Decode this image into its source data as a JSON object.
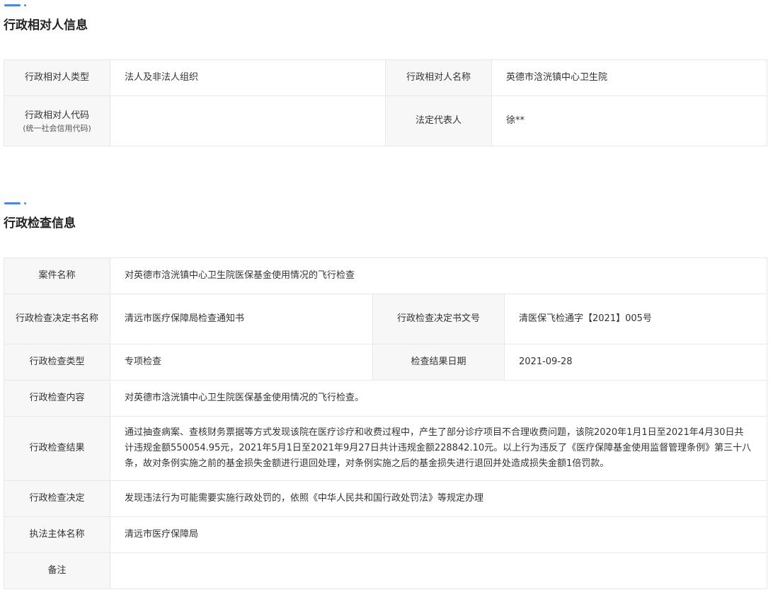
{
  "party_section": {
    "title": "行政相对人信息",
    "rows": {
      "type_label": "行政相对人类型",
      "type_value": "法人及非法人组织",
      "name_label": "行政相对人名称",
      "name_value": "英德市浛洸镇中心卫生院",
      "code_label": "行政相对人代码",
      "code_sublabel": "(统一社会信用代码)",
      "code_value": "",
      "rep_label": "法定代表人",
      "rep_value": "徐**"
    }
  },
  "inspection_section": {
    "title": "行政检查信息",
    "rows": {
      "case_label": "案件名称",
      "case_value": "对英德市浛洸镇中心卫生院医保基金使用情况的飞行检查",
      "doc_label": "行政检查决定书名称",
      "doc_value": "清远市医疗保障局检查通知书",
      "docno_label": "行政检查决定书文号",
      "docno_value": "清医保飞检通字【2021】005号",
      "type_label": "行政检查类型",
      "type_value": "专项检查",
      "date_label": "检查结果日期",
      "date_value": "2021-09-28",
      "content_label": "行政检查内容",
      "content_value": "对英德市浛洸镇中心卫生院医保基金使用情况的飞行检查。",
      "result_label": "行政检查结果",
      "result_value": "通过抽查病案、查核财务票据等方式发现该院在医疗诊疗和收费过程中，产生了部分诊疗项目不合理收费问题，该院2020年1月1日至2021年4月30日共计违规金额550054.95元，2021年5月1日至2021年9月27日共计违规金额228842.10元。以上行为违反了《医疗保障基金使用监督管理条例》第三十八条，故对条例实施之前的基金损失金额进行退回处理，对条例实施之后的基金损失进行退回并处造成损失金额1倍罚款。",
      "decision_label": "行政检查决定",
      "decision_value": "发现违法行为可能需要实施行政处罚的，依照《中华人民共和国行政处罚法》等规定办理",
      "agency_label": "执法主体名称",
      "agency_value": "清远市医疗保障局",
      "remark_label": "备注",
      "remark_value": ""
    }
  }
}
